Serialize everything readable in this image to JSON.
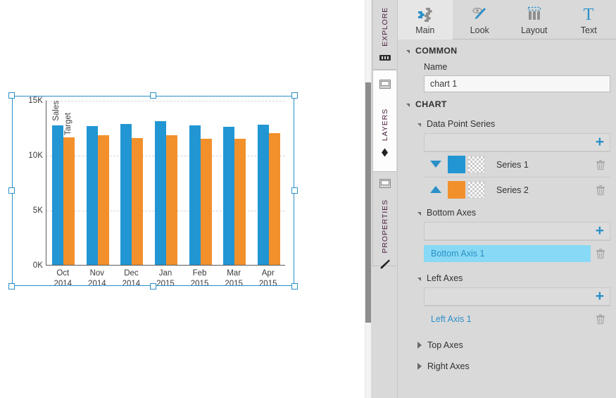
{
  "canvas": {
    "chart_name_on_canvas": "chart 1"
  },
  "tabstrip": {
    "tabs": [
      {
        "label": "EXPLORE",
        "icon": "explore-icon",
        "active": false
      },
      {
        "label": "LAYERS",
        "icon": "layers-icon",
        "active": true
      },
      {
        "label": "PROPERTIES",
        "icon": "pencil-icon",
        "active": false
      }
    ]
  },
  "panel": {
    "tabs": [
      {
        "label": "Main",
        "icon": "puzzle-icon",
        "active": true
      },
      {
        "label": "Look",
        "icon": "eye-brush-icon",
        "active": false
      },
      {
        "label": "Layout",
        "icon": "columns-icon",
        "active": false
      },
      {
        "label": "Text",
        "icon": "text-t-icon",
        "active": false
      }
    ],
    "common": {
      "title": "COMMON",
      "name_label": "Name",
      "name_value": "chart 1"
    },
    "chart": {
      "title": "CHART",
      "data_point_series": {
        "title": "Data Point Series",
        "items": [
          {
            "name": "Series 1",
            "color": "#2196d3",
            "direction": "down"
          },
          {
            "name": "Series 2",
            "color": "#f2902c",
            "direction": "up"
          }
        ]
      },
      "bottom_axes": {
        "title": "Bottom Axes",
        "items": [
          {
            "name": "Bottom Axis 1",
            "selected": true
          }
        ]
      },
      "left_axes": {
        "title": "Left Axes",
        "items": [
          {
            "name": "Left Axis 1",
            "selected": false
          }
        ]
      },
      "top_axes": {
        "title": "Top Axes",
        "collapsed": true
      },
      "right_axes": {
        "title": "Right Axes",
        "collapsed": true
      }
    }
  },
  "chart_data": {
    "type": "bar",
    "title": "",
    "xlabel": "",
    "ylabel": "",
    "categories": [
      "Oct\n2014",
      "Nov\n2014",
      "Dec\n2014",
      "Jan\n2015",
      "Feb\n2015",
      "Mar\n2015",
      "Apr\n2015"
    ],
    "category_lines": [
      [
        "Oct",
        "2014"
      ],
      [
        "Nov",
        "2014"
      ],
      [
        "Dec",
        "2014"
      ],
      [
        "Jan",
        "2015"
      ],
      [
        "Feb",
        "2015"
      ],
      [
        "Mar",
        "2015"
      ],
      [
        "Apr",
        "2015"
      ]
    ],
    "series": [
      {
        "name": "Sales",
        "color": "#2196d3",
        "values": [
          12700,
          12650,
          12850,
          13100,
          12680,
          12560,
          12740
        ]
      },
      {
        "name": "Target",
        "color": "#f2902c",
        "values": [
          11600,
          11800,
          11560,
          11780,
          11490,
          11490,
          11980
        ]
      }
    ],
    "ylim": [
      0,
      15000
    ],
    "yticks": [
      0,
      5000,
      10000,
      15000
    ],
    "ytick_labels": [
      "0K",
      "5K",
      "10K",
      "15K"
    ],
    "grid": true,
    "legend": "none",
    "series_tags_on_plot": [
      "Sales",
      "Target"
    ]
  }
}
